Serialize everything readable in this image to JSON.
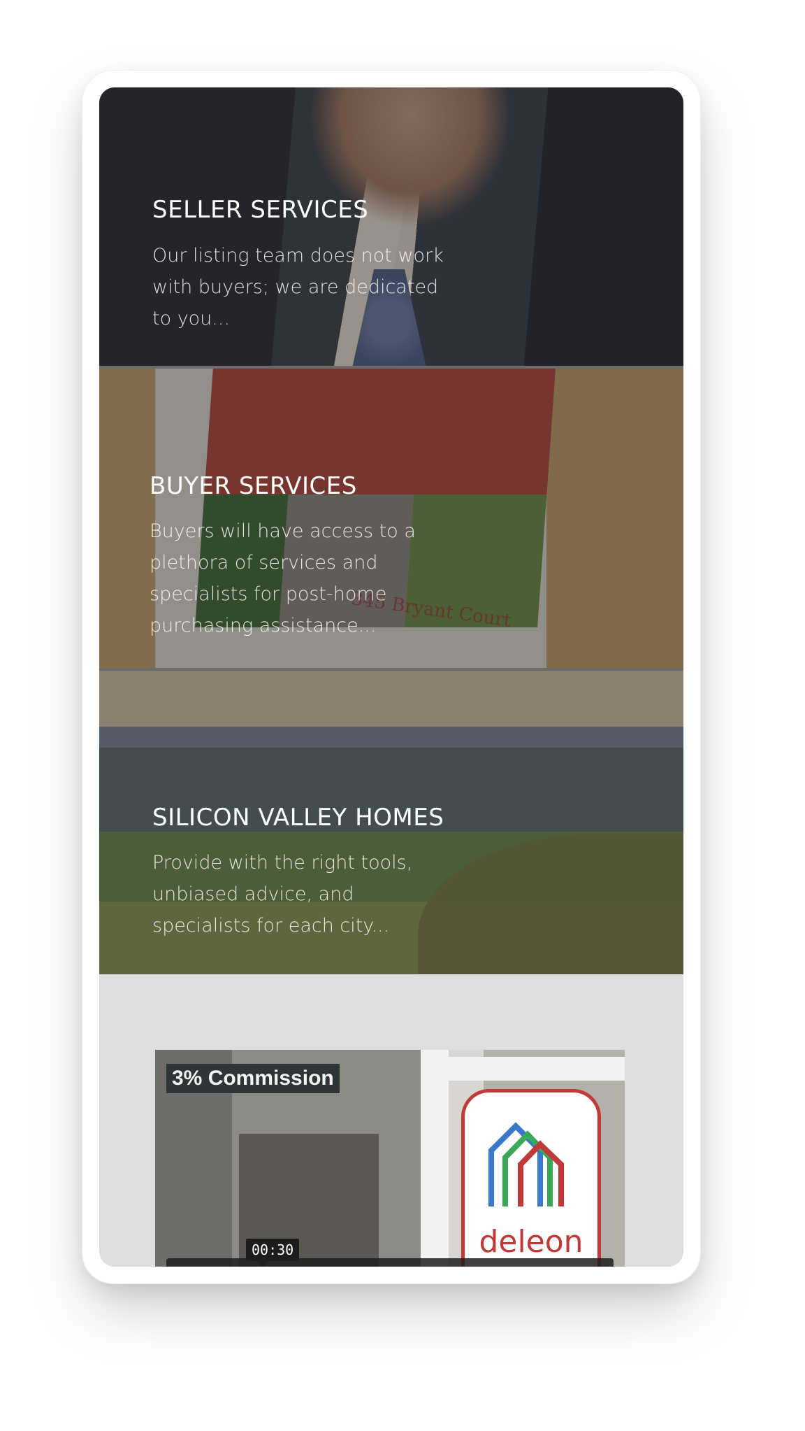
{
  "cards": [
    {
      "title": "SELLER SERVICES",
      "description": "Our listing team does not work with buyers; we are dedicated to you..."
    },
    {
      "title": "BUYER SERVICES",
      "description": "Buyers will have access to a plethora of services and specialists for post-home purchasing assistance...",
      "photo_text": "345 Bryant Court"
    },
    {
      "title": "SILICON VALLEY HOMES",
      "description": "Provide with the right tools, unbiased advice, and specialists for each city..."
    }
  ],
  "video": {
    "overlay_label": "3% Commission",
    "timestamp": "00:30",
    "sign_brand": "deleon"
  },
  "colors": {
    "overlay": "#1e1e22",
    "sign_red": "#c03a3a"
  }
}
